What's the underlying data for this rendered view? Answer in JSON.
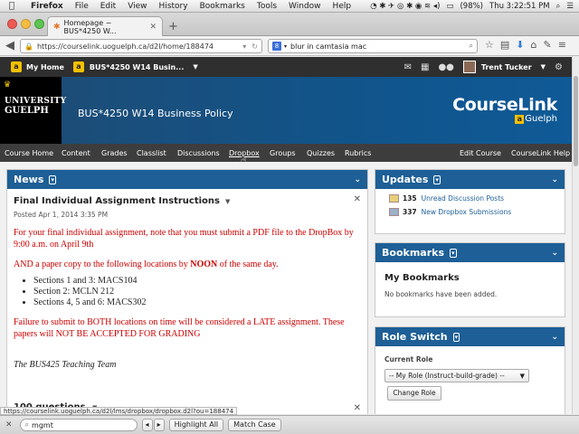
{
  "mac": {
    "apple": "",
    "app": "Firefox",
    "menus": [
      "File",
      "Edit",
      "View",
      "History",
      "Bookmarks",
      "Tools",
      "Window",
      "Help"
    ],
    "battery": "(98%)",
    "clock": "Thu 3:22:51 PM"
  },
  "tab": {
    "title": "Homepage ~ BUS*4250 W..."
  },
  "nav": {
    "url": "https://courselink.uoguelph.ca/d2l/home/188474",
    "search_value": "blur in camtasia mac"
  },
  "d2l": {
    "my_home": "My Home",
    "course_selector": "BUS*4250 W14 Busin...",
    "user": "Trent Tucker"
  },
  "banner": {
    "course_title": "BUS*4250 W14 Business Policy",
    "logo_line1": "UNIVERSITY",
    "logo_line2": "GUELPH",
    "brand": "CourseLink",
    "brand_sub": "Guelph"
  },
  "course_nav": [
    "Course Home",
    "Content",
    "Grades",
    "Classlist",
    "Discussions",
    "Dropbox",
    "Groups",
    "Quizzes",
    "Rubrics",
    "Edit Course",
    "CourseLink Help"
  ],
  "news": {
    "title": "News",
    "item1": {
      "title": "Final Individual Assignment Instructions",
      "posted": "Posted Apr 1, 2014 3:35 PM",
      "para1": "For your final individual assignment, note that you must submit a PDF file to the DropBox by 9:00 a.m. on April 9th",
      "para2_a": "AND a paper copy to the following locations by ",
      "para2_b": "NOON",
      "para2_c": " of the same day.",
      "bullets": [
        "Sections 1 and 3: MACS104",
        "Section 2: MCLN 212",
        "Sections 4, 5 and 6: MACS302"
      ],
      "para3": "Failure to submit to BOTH locations on time will be considered a LATE assignment. These papers will NOT BE ACCEPTED FOR GRADING",
      "signature": "The BUS425 Teaching Team"
    },
    "item2": {
      "title": "100 questions"
    }
  },
  "updates": {
    "title": "Updates",
    "rows": [
      {
        "count": "135",
        "label": "Unread Discussion Posts"
      },
      {
        "count": "337",
        "label": "New Dropbox Submissions"
      }
    ]
  },
  "bookmarks": {
    "title": "Bookmarks",
    "heading": "My Bookmarks",
    "empty": "No bookmarks have been added."
  },
  "role_switch": {
    "title": "Role Switch",
    "label": "Current Role",
    "selected": "-- My Role (Instruct-build-grade) --",
    "button": "Change Role"
  },
  "status_url": "https://courselink.uoguelph.ca/d2l/lms/dropbox/dropbox.d2l?ou=188474",
  "find": {
    "value": "mgmt",
    "highlight_all": "Highlight All",
    "match_case": "Match Case"
  },
  "colors": {
    "header_blue": "#1d5f96",
    "alert_red": "#cc0000",
    "guelph_yellow": "#f6c000"
  }
}
